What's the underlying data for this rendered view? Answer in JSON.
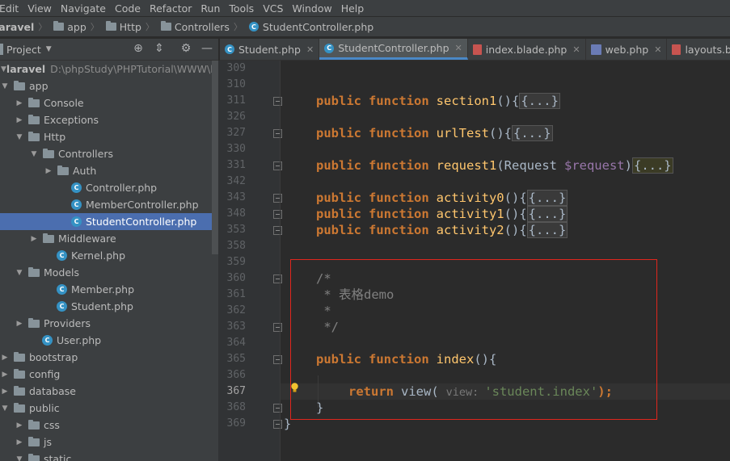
{
  "menu": [
    "Edit",
    "View",
    "Navigate",
    "Code",
    "Refactor",
    "Run",
    "Tools",
    "VCS",
    "Window",
    "Help"
  ],
  "menu_underline": [
    "E",
    "V",
    "N",
    "C",
    "R",
    "R",
    "T",
    "V",
    "W",
    "H"
  ],
  "breadcrumb": [
    "laravel",
    "app",
    "Http",
    "Controllers",
    "StudentController.php"
  ],
  "project_panel": {
    "title": "Project"
  },
  "tree": [
    {
      "label": "laravel",
      "path": "D:\\phpStudy\\PHPTutorial\\WWW\\lar",
      "depth": 0,
      "kind": "folder",
      "open": true,
      "bold": true
    },
    {
      "label": "app",
      "depth": 0,
      "kind": "folder",
      "open": true
    },
    {
      "label": "Console",
      "depth": 1,
      "kind": "folder",
      "open": false
    },
    {
      "label": "Exceptions",
      "depth": 1,
      "kind": "folder",
      "open": false
    },
    {
      "label": "Http",
      "depth": 1,
      "kind": "folder",
      "open": true
    },
    {
      "label": "Controllers",
      "depth": 2,
      "kind": "folder",
      "open": true
    },
    {
      "label": "Auth",
      "depth": 3,
      "kind": "folder",
      "open": false
    },
    {
      "label": "Controller.php",
      "depth": 3,
      "kind": "class"
    },
    {
      "label": "MemberController.php",
      "depth": 3,
      "kind": "class"
    },
    {
      "label": "StudentController.php",
      "depth": 3,
      "kind": "class",
      "selected": true
    },
    {
      "label": "Middleware",
      "depth": 2,
      "kind": "folder",
      "open": false
    },
    {
      "label": "Kernel.php",
      "depth": 2,
      "kind": "class"
    },
    {
      "label": "Models",
      "depth": 1,
      "kind": "folder",
      "open": true
    },
    {
      "label": "Member.php",
      "depth": 2,
      "kind": "class"
    },
    {
      "label": "Student.php",
      "depth": 2,
      "kind": "class"
    },
    {
      "label": "Providers",
      "depth": 1,
      "kind": "folder",
      "open": false
    },
    {
      "label": "User.php",
      "depth": 1,
      "kind": "class"
    },
    {
      "label": "bootstrap",
      "depth": 0,
      "kind": "folder",
      "open": false
    },
    {
      "label": "config",
      "depth": 0,
      "kind": "folder",
      "open": false
    },
    {
      "label": "database",
      "depth": 0,
      "kind": "folder",
      "open": false
    },
    {
      "label": "public",
      "depth": 0,
      "kind": "folder",
      "open": true
    },
    {
      "label": "css",
      "depth": 1,
      "kind": "folder",
      "open": false
    },
    {
      "label": "js",
      "depth": 1,
      "kind": "folder",
      "open": false
    },
    {
      "label": "static",
      "depth": 1,
      "kind": "folder",
      "open": true
    }
  ],
  "tabs": [
    {
      "label": "Student.php",
      "icon": "class",
      "active": false
    },
    {
      "label": "StudentController.php",
      "icon": "class",
      "active": true
    },
    {
      "label": "index.blade.php",
      "icon": "blade",
      "active": false
    },
    {
      "label": "web.php",
      "icon": "php",
      "active": false
    },
    {
      "label": "layouts.blade.php",
      "icon": "blade",
      "active": false
    }
  ],
  "editor": {
    "line_numbers": [
      "309",
      "310",
      "311",
      "326",
      "327",
      "330",
      "331",
      "342",
      "343",
      "348",
      "353",
      "358",
      "359",
      "360",
      "361",
      "362",
      "363",
      "364",
      "365",
      "366",
      "367",
      "368",
      "369"
    ],
    "current_line": "367",
    "kw_public": "public",
    "kw_function": "function",
    "kw_return": "return",
    "fn_section1": "section1",
    "fn_urlTest": "urlTest",
    "fn_request1": "request1",
    "fn_activity0": "activity0",
    "fn_activity1": "activity1",
    "fn_activity2": "activity2",
    "fn_index": "index",
    "param_type": "Request",
    "param_var": "$request",
    "parens_open": "(){",
    "parens_close": ")",
    "folded": "{...}",
    "comment_open": "/*",
    "comment_text": " * 表格demo",
    "comment_star": " *",
    "comment_close": " */",
    "brace_close": "}",
    "call_view": "view(",
    "param_hint": "view:",
    "string_arg": "'student.index'",
    "stmt_end": ");"
  },
  "colors": {
    "keyword": "#cc7832",
    "function_name": "#ffc66d",
    "string": "#6a8759",
    "comment": "#808080",
    "selection": "#4b6eaf",
    "highlight_box": "#e0261d"
  }
}
